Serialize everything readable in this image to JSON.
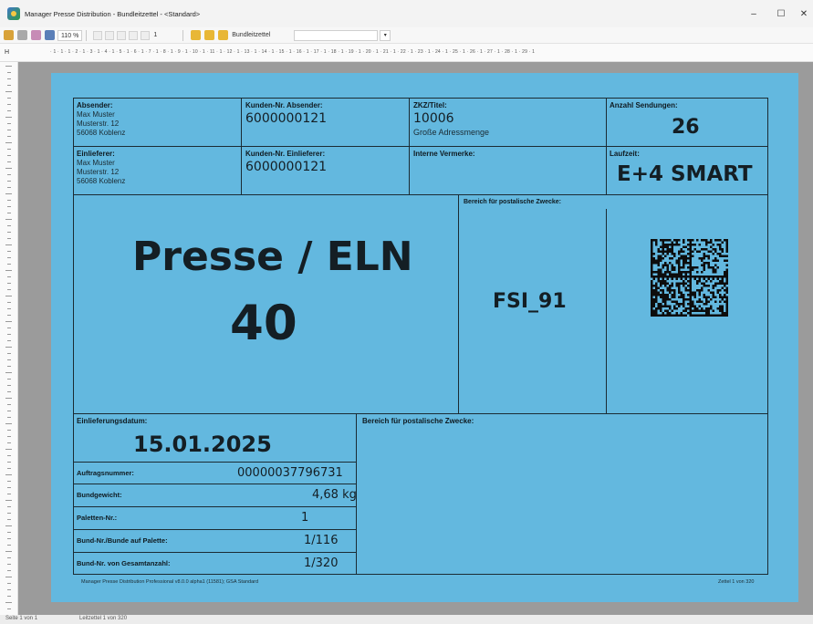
{
  "window": {
    "title": "Manager Presse Distribution - Bundleitzettel - <Standard>",
    "minimize": "–",
    "maximize": "☐",
    "close": "✕"
  },
  "toolbar": {
    "zoom": "110 %",
    "page_field": "1",
    "report_label": "Bundleitzettel"
  },
  "ruler": {
    "h_label": "H",
    "ticks": "· 1 · 1 · 1 · 2 · 1 · 3 · 1 · 4 · 1 · 5 · 1 · 6 · 1 · 7 · 1 · 8 · 1 · 9 · 1 · 10 · 1 · 11 · 1 · 12 · 1 · 13 · 1 · 14 · 1 · 15 · 1 · 16 · 1 · 17 · 1 · 18 · 1 · 19 · 1 · 20 · 1 · 21 · 1 · 22 · 1 · 23 · 1 · 24 · 1 · 25 · 1 · 26 · 1 · 27 · 1 · 28 · 1 · 29 · 1"
  },
  "label": {
    "absender": {
      "title": "Absender:",
      "lines": [
        "Max Muster",
        "Musterstr. 12",
        "56068 Koblenz"
      ]
    },
    "kunden_absender": {
      "title": "Kunden-Nr. Absender:",
      "value": "6000000121"
    },
    "zkz": {
      "title": "ZKZ/Titel:",
      "value": "10006",
      "sub": "Große Adressmenge"
    },
    "anzahl": {
      "title": "Anzahl Sendungen:",
      "value": "26"
    },
    "einlieferer": {
      "title": "Einlieferer:",
      "lines": [
        "Max Muster",
        "Musterstr. 12",
        "56068 Koblenz"
      ]
    },
    "kunden_einlieferer": {
      "title": "Kunden-Nr. Einlieferer:",
      "value": "6000000121"
    },
    "interne": {
      "title": "Interne Vermerke:"
    },
    "laufzeit": {
      "title": "Laufzeit:",
      "value": "E+4 SMART"
    },
    "main": {
      "line1": "Presse / ELN",
      "line2": "40"
    },
    "postal_area_1": {
      "title": "Bereich für postalische Zwecke:",
      "code": "FSI_91"
    },
    "einlieferungsdatum": {
      "title": "Einlieferungsdatum:",
      "value": "15.01.2025"
    },
    "postal_area_2": {
      "title": "Bereich für postalische Zwecke:"
    },
    "details": [
      {
        "label": "Auftragsnummer:",
        "value": "00000037796731"
      },
      {
        "label": "Bundgewicht:",
        "value": "4,68 kg"
      },
      {
        "label": "Paletten-Nr.:",
        "value": "1"
      },
      {
        "label": "Bund-Nr./Bunde auf Palette:",
        "value": "1/116"
      },
      {
        "label": "Bund-Nr. von Gesamtanzahl:",
        "value": "1/320"
      }
    ],
    "footer_left": "Manager Presse Distribution Professional v8.0.0 alpha1 (11581); GSA Standard",
    "footer_right": "Zettel 1 von 320"
  },
  "status": {
    "left": "Seite 1 von 1",
    "right": "Leitzettel 1 von 320"
  },
  "colors": {
    "label_bg": "#63b8df",
    "canvas_bg": "#9b9b9b",
    "border": "#1b2b33"
  }
}
